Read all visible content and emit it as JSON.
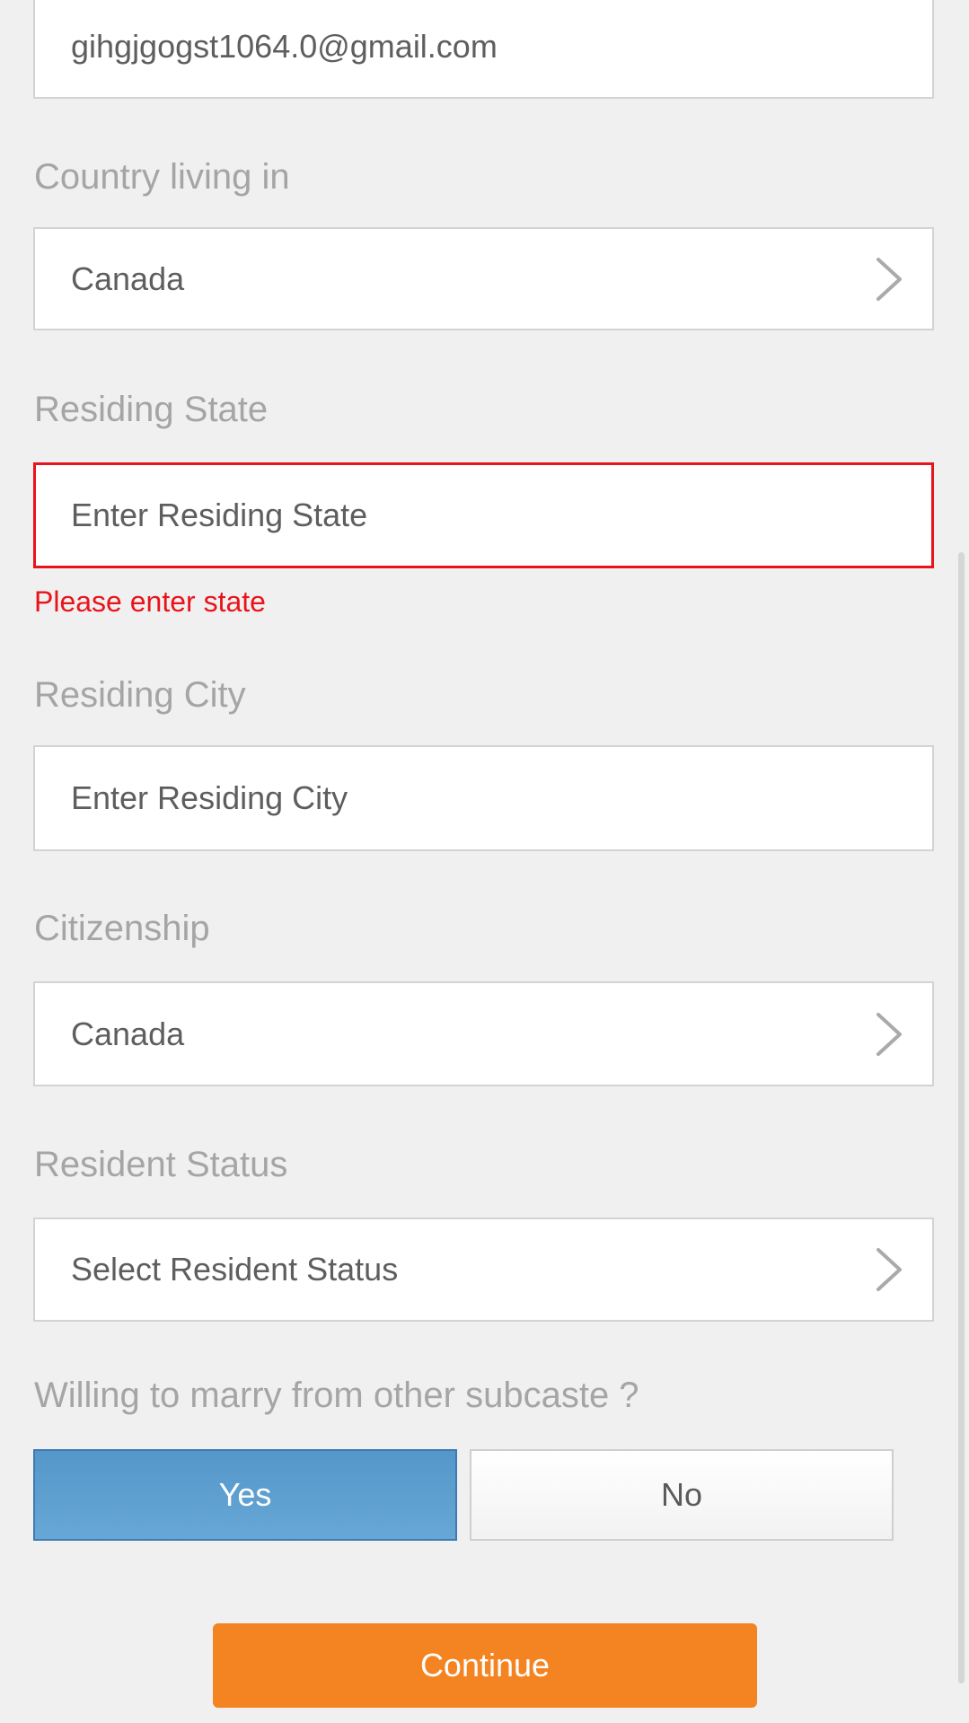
{
  "email": {
    "value": "gihgjgogst1064.0@gmail.com"
  },
  "country": {
    "label": "Country living in",
    "value": "Canada",
    "chevron_icon": "chevron-right-icon"
  },
  "state": {
    "label": "Residing State",
    "placeholder": "Enter Residing State",
    "error": "Please enter state"
  },
  "city": {
    "label": "Residing City",
    "placeholder": "Enter Residing City"
  },
  "citizenship": {
    "label": "Citizenship",
    "value": "Canada",
    "chevron_icon": "chevron-right-icon"
  },
  "resident_status": {
    "label": "Resident Status",
    "value": "Select Resident Status",
    "chevron_icon": "chevron-right-icon"
  },
  "subcaste": {
    "question": "Willing to marry from other subcaste ?",
    "yes_label": "Yes",
    "no_label": "No",
    "selected": "Yes"
  },
  "continue_label": "Continue",
  "colors": {
    "background": "#f0f0f0",
    "error": "#e8141c",
    "selected_blue": "#5a9bcd",
    "continue_orange": "#f48422",
    "label_gray": "#a5a5a5"
  }
}
